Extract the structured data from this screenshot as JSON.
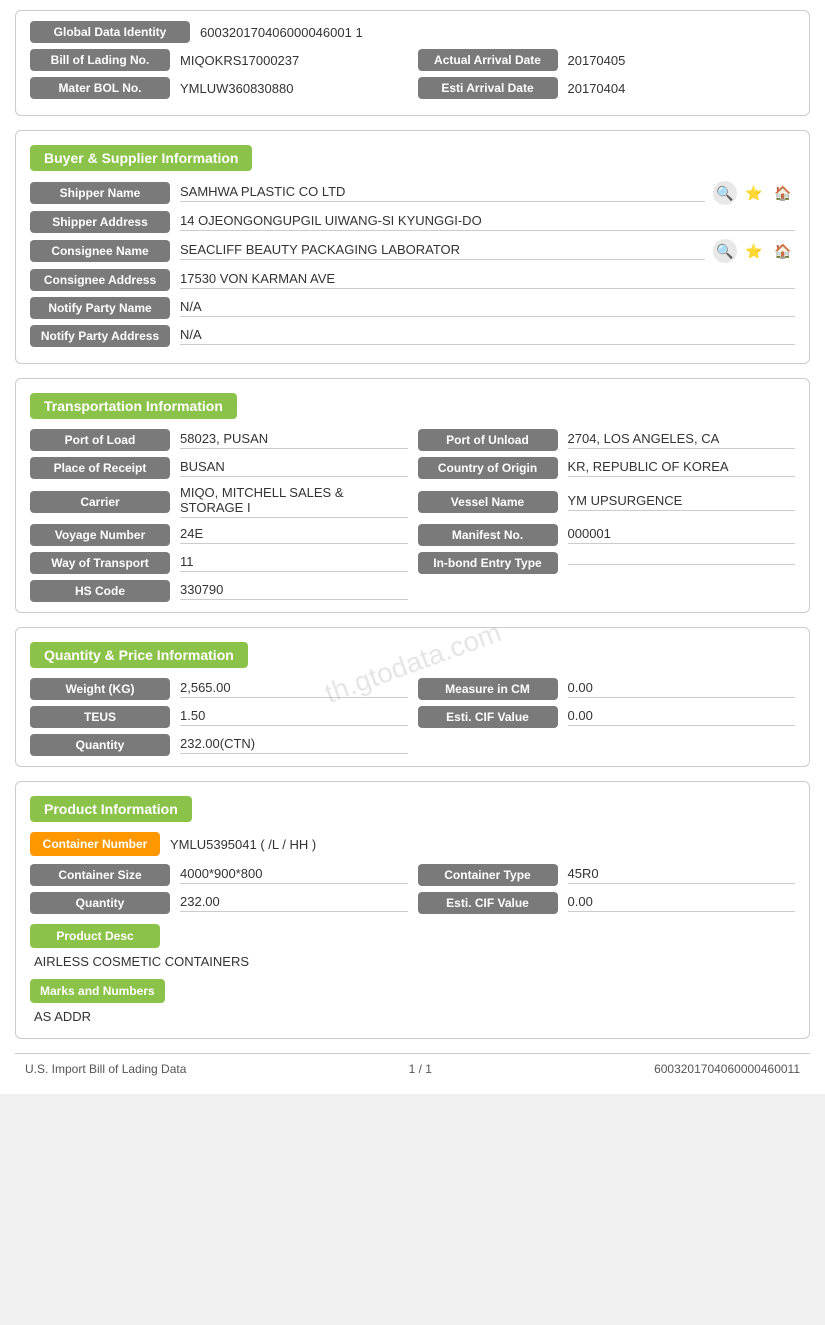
{
  "identity": {
    "global_data_identity_label": "Global Data Identity",
    "global_data_identity_value": "600320170406000046001 1",
    "bill_of_lading_label": "Bill of Lading No.",
    "bill_of_lading_value": "MIQOKRS17000237",
    "actual_arrival_date_label": "Actual Arrival Date",
    "actual_arrival_date_value": "20170405",
    "mater_bol_label": "Mater BOL No.",
    "mater_bol_value": "YMLUW360830880",
    "esti_arrival_date_label": "Esti Arrival Date",
    "esti_arrival_date_value": "20170404"
  },
  "buyer_supplier": {
    "section_title": "Buyer & Supplier Information",
    "shipper_name_label": "Shipper Name",
    "shipper_name_value": "SAMHWA PLASTIC CO LTD",
    "shipper_address_label": "Shipper Address",
    "shipper_address_value": "14 OJEONGONGUPGIL UIWANG-SI KYUNGGI-DO",
    "consignee_name_label": "Consignee Name",
    "consignee_name_value": "SEACLIFF BEAUTY PACKAGING LABORATOR",
    "consignee_address_label": "Consignee Address",
    "consignee_address_value": "17530 VON KARMAN AVE",
    "notify_party_name_label": "Notify Party Name",
    "notify_party_name_value": "N/A",
    "notify_party_address_label": "Notify Party Address",
    "notify_party_address_value": "N/A"
  },
  "transportation": {
    "section_title": "Transportation Information",
    "port_of_load_label": "Port of Load",
    "port_of_load_value": "58023, PUSAN",
    "port_of_unload_label": "Port of Unload",
    "port_of_unload_value": "2704, LOS ANGELES, CA",
    "place_of_receipt_label": "Place of Receipt",
    "place_of_receipt_value": "BUSAN",
    "country_of_origin_label": "Country of Origin",
    "country_of_origin_value": "KR, REPUBLIC OF KOREA",
    "carrier_label": "Carrier",
    "carrier_value": "MIQO, MITCHELL SALES & STORAGE I",
    "vessel_name_label": "Vessel Name",
    "vessel_name_value": "YM UPSURGENCE",
    "voyage_number_label": "Voyage Number",
    "voyage_number_value": "24E",
    "manifest_no_label": "Manifest No.",
    "manifest_no_value": "000001",
    "way_of_transport_label": "Way of Transport",
    "way_of_transport_value": "11",
    "in_bond_entry_type_label": "In-bond Entry Type",
    "in_bond_entry_type_value": "",
    "hs_code_label": "HS Code",
    "hs_code_value": "330790"
  },
  "quantity_price": {
    "section_title": "Quantity & Price Information",
    "weight_label": "Weight (KG)",
    "weight_value": "2,565.00",
    "measure_in_cm_label": "Measure in CM",
    "measure_in_cm_value": "0.00",
    "teus_label": "TEUS",
    "teus_value": "1.50",
    "esti_cif_value_label": "Esti. CIF Value",
    "esti_cif_value_value": "0.00",
    "quantity_label": "Quantity",
    "quantity_value": "232.00(CTN)"
  },
  "product_information": {
    "section_title": "Product Information",
    "container_number_label": "Container Number",
    "container_number_value": "YMLU5395041 ( /L / HH )",
    "container_size_label": "Container Size",
    "container_size_value": "4000*900*800",
    "container_type_label": "Container Type",
    "container_type_value": "45R0",
    "quantity_label": "Quantity",
    "quantity_value": "232.00",
    "esti_cif_label": "Esti. CIF Value",
    "esti_cif_value": "0.00",
    "product_desc_label": "Product Desc",
    "product_desc_text": "AIRLESS COSMETIC CONTAINERS",
    "marks_and_numbers_label": "Marks and Numbers",
    "marks_and_numbers_text": "AS ADDR"
  },
  "footer": {
    "left": "U.S. Import Bill of Lading Data",
    "center": "1 / 1",
    "right": "6003201704060000460011"
  },
  "watermark": "th.gtodata.com"
}
